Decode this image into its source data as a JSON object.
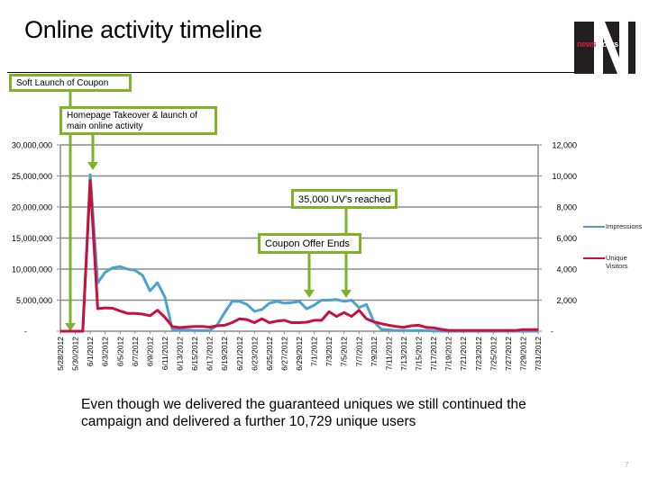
{
  "page": {
    "title": "Online activity timeline",
    "logo": {
      "part1": "news",
      "part2": "works",
      "letter": "N"
    },
    "footer_text": "Even though we delivered the guaranteed uniques we still continued the campaign and delivered a further 10,729 unique users",
    "page_number": "7"
  },
  "callouts": [
    {
      "label": "Soft Launch of Coupon",
      "target_date": "5/28/2012"
    },
    {
      "label": "Homepage Takeover & launch of main online activity",
      "target_date": "6/1/2012"
    },
    {
      "label": "35,000 UV's reached",
      "target_date": "7/5/2012"
    },
    {
      "label": "Coupon Offer Ends",
      "target_date": "7/2/2012"
    }
  ],
  "colors": {
    "impressions": "#4ba3cc",
    "unique_visitors": "#c8103e",
    "callout_border": "#7fb12b",
    "grid": "#8c8c8c"
  },
  "chart_data": {
    "type": "line",
    "title": "",
    "xlabel": "",
    "ylabel": "",
    "y_primary": {
      "range": [
        0,
        30000000
      ],
      "ticks": [
        "-",
        "5,000,000",
        "10,000,000",
        "15,000,000",
        "20,000,000",
        "25,000,000",
        "30,000,000"
      ]
    },
    "y_secondary": {
      "range": [
        0,
        12000
      ],
      "ticks": [
        "-",
        "2,000",
        "4,000",
        "6,000",
        "8,000",
        "10,000",
        "12,000"
      ]
    },
    "grid": true,
    "legend_position": "right",
    "x_start": "5/28/2012",
    "x_end": "7/31/2012",
    "x_tick_labels": [
      "5/28/2012",
      "5/30/2012",
      "6/1/2012",
      "6/3/2012",
      "6/5/2012",
      "6/7/2012",
      "6/9/2012",
      "6/11/2012",
      "6/13/2012",
      "6/15/2012",
      "6/17/2012",
      "6/19/2012",
      "6/21/2012",
      "6/23/2012",
      "6/25/2012",
      "6/27/2012",
      "6/29/2012",
      "7/1/2012",
      "7/3/2012",
      "7/5/2012",
      "7/7/2012",
      "7/9/2012",
      "7/11/2012",
      "7/13/2012",
      "7/15/2012",
      "7/17/2012",
      "7/19/2012",
      "7/21/2012",
      "7/23/2012",
      "7/25/2012",
      "7/27/2012",
      "7/29/2012",
      "7/31/2012"
    ],
    "series": [
      {
        "name": "Impressions",
        "axis": "primary",
        "values": [
          0,
          0,
          0,
          0,
          25200000,
          7800000,
          9500000,
          10200000,
          10400000,
          10000000,
          9800000,
          9000000,
          6500000,
          7800000,
          5500000,
          300000,
          200000,
          200000,
          100000,
          100000,
          100000,
          1000000,
          3000000,
          4800000,
          4800000,
          4300000,
          3200000,
          3500000,
          4500000,
          4800000,
          4500000,
          4600000,
          4800000,
          3600000,
          4200000,
          5000000,
          5000000,
          5100000,
          4800000,
          5000000,
          3800000,
          4300000,
          1500000,
          300000,
          200000,
          100000,
          100000,
          100000,
          100000,
          100000,
          50000,
          0,
          0,
          0,
          0,
          0,
          0,
          0,
          0,
          0,
          0,
          0,
          0,
          0,
          0
        ]
      },
      {
        "name": "Unique Visitors",
        "axis": "secondary",
        "values": [
          0,
          0,
          0,
          0,
          9700,
          1450,
          1500,
          1480,
          1300,
          1150,
          1150,
          1100,
          1000,
          1350,
          900,
          300,
          230,
          280,
          300,
          300,
          260,
          350,
          380,
          550,
          800,
          750,
          550,
          800,
          550,
          650,
          700,
          550,
          550,
          580,
          700,
          700,
          1250,
          950,
          1200,
          950,
          1350,
          800,
          600,
          480,
          380,
          300,
          250,
          350,
          380,
          250,
          220,
          120,
          50,
          50,
          50,
          50,
          50,
          50,
          50,
          50,
          50,
          50,
          100,
          100,
          100
        ]
      }
    ]
  }
}
